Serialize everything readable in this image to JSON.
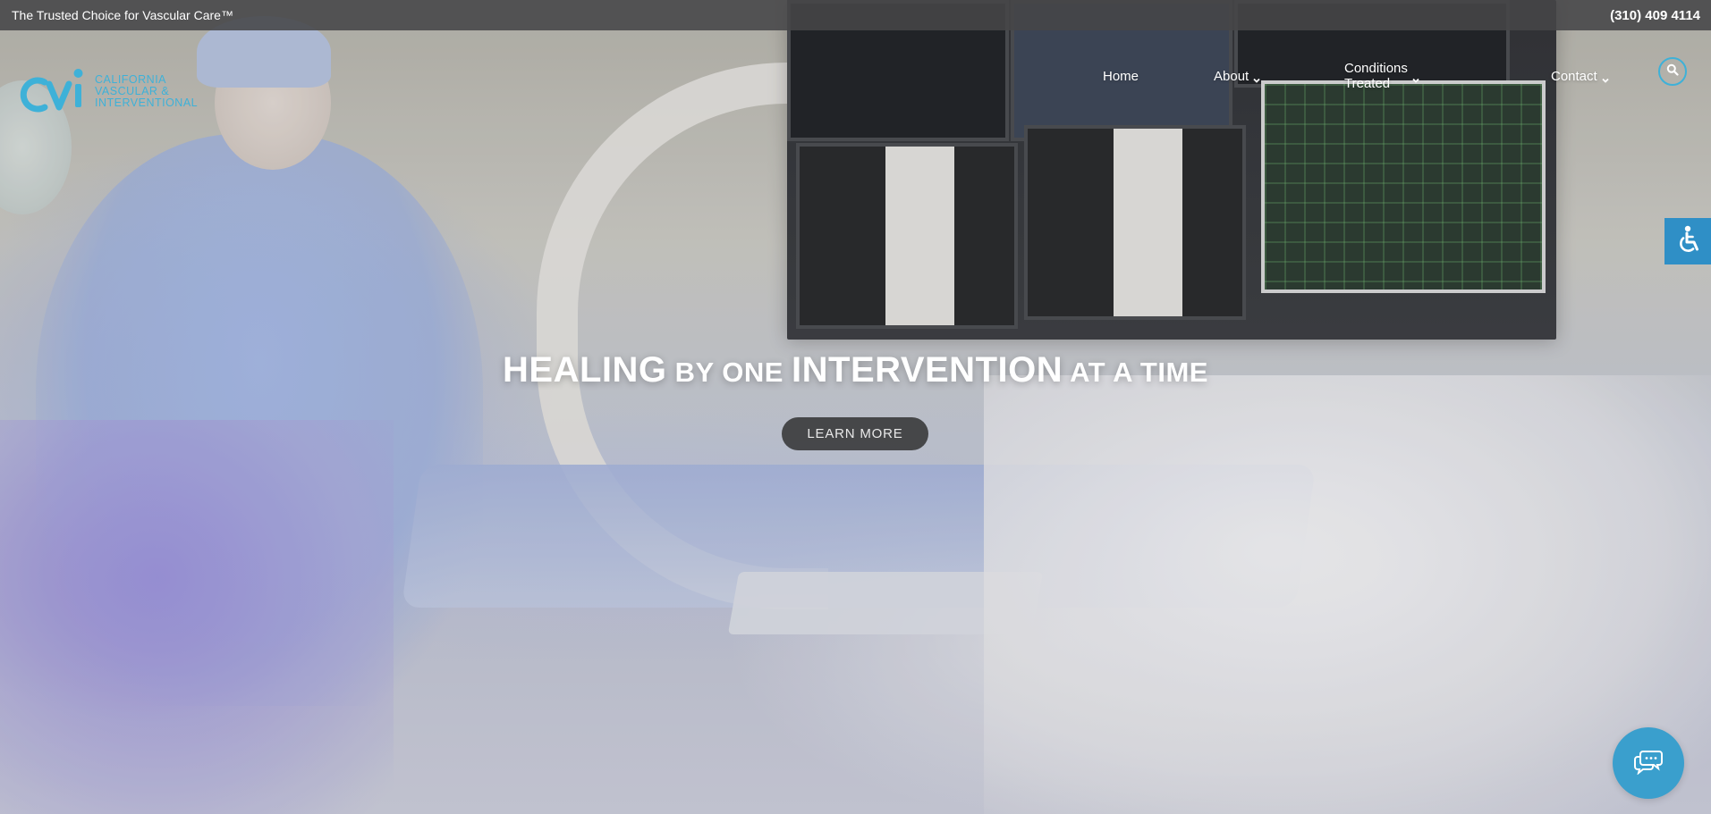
{
  "topbar": {
    "tagline": "The Trusted Choice for Vascular Care™",
    "phone": "(310) 409 4114"
  },
  "logo": {
    "mark": "cvi",
    "lines": [
      "CALIFORNIA",
      "VASCULAR &",
      "INTERVENTIONAL"
    ],
    "color": "#3eb1d8"
  },
  "nav": {
    "items": [
      {
        "label": "Home",
        "has_dropdown": false
      },
      {
        "label": "About",
        "has_dropdown": true
      },
      {
        "label": "Conditions Treated",
        "has_dropdown": true
      },
      {
        "label": "Contact",
        "has_dropdown": true
      }
    ],
    "search_icon": "search-icon"
  },
  "hero": {
    "title_parts": [
      {
        "text": "HEALING",
        "size": "big"
      },
      {
        "text": " BY ONE ",
        "size": "small"
      },
      {
        "text": "INTERVENTION",
        "size": "big"
      },
      {
        "text": " AT A TIME",
        "size": "small"
      }
    ],
    "cta_label": "LEARN MORE"
  },
  "widgets": {
    "accessibility_icon": "wheelchair-icon",
    "chat_icon": "chat-bubbles-icon",
    "accent_color": "#3eb1d8",
    "accessibility_color": "#2f8fc6",
    "chat_color": "#3a9fcd"
  }
}
